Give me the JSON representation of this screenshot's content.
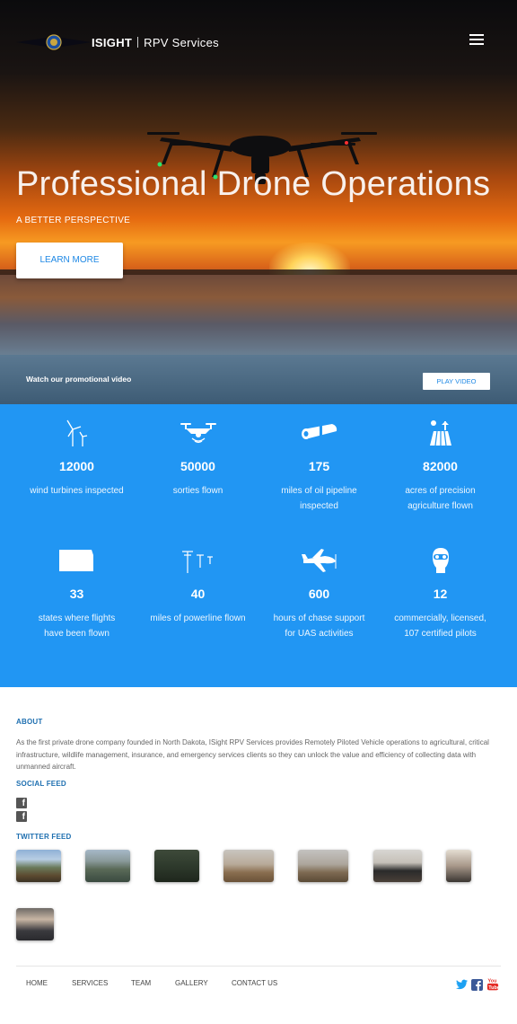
{
  "brand": {
    "name_bold": "ISIGHT",
    "name_rest": "RPV Services"
  },
  "hero": {
    "title": "Professional Drone Operations",
    "subtitle": "A BETTER PERSPECTIVE",
    "cta_label": "LEARN MORE"
  },
  "video": {
    "text": "Watch our promotional video",
    "button_label": "PLAY VIDEO"
  },
  "stats": [
    {
      "icon": "wind-turbine-icon",
      "value": "12000",
      "label": "wind turbines inspected"
    },
    {
      "icon": "drone-icon",
      "value": "50000",
      "label": "sorties flown"
    },
    {
      "icon": "pipeline-icon",
      "value": "175",
      "label": "miles of oil pipeline inspected"
    },
    {
      "icon": "farm-field-icon",
      "value": "82000",
      "label": "acres of precision agriculture flown"
    },
    {
      "icon": "state-map-icon",
      "value": "33",
      "label": "states where flights have been flown"
    },
    {
      "icon": "powerline-icon",
      "value": "40",
      "label": "miles of powerline flown"
    },
    {
      "icon": "airplane-icon",
      "value": "600",
      "label": "hours of chase support for UAS activities"
    },
    {
      "icon": "pilot-icon",
      "value": "12",
      "label": "commercially, licensed, 107 certified pilots"
    }
  ],
  "about": {
    "heading": "ABOUT",
    "text": "As the first private drone company founded in North Dakota, ISight RPV Services provides Remotely Piloted Vehicle operations to agricultural, critical infrastructure, wildlife management, insurance, and emergency services clients so they can unlock the value and efficiency of collecting data with unmanned aircraft."
  },
  "social_feed": {
    "heading": "SOCIAL FEED"
  },
  "twitter_feed": {
    "heading": "TWITTER FEED"
  },
  "footer": {
    "nav": [
      "HOME",
      "SERVICES",
      "TEAM",
      "GALLERY",
      "CONTACT US"
    ]
  },
  "colors": {
    "accent": "#2196f3",
    "heading": "#1e6fb0",
    "twitter": "#1da1f2",
    "facebook": "#3b5998",
    "youtube": "#e52d27"
  }
}
